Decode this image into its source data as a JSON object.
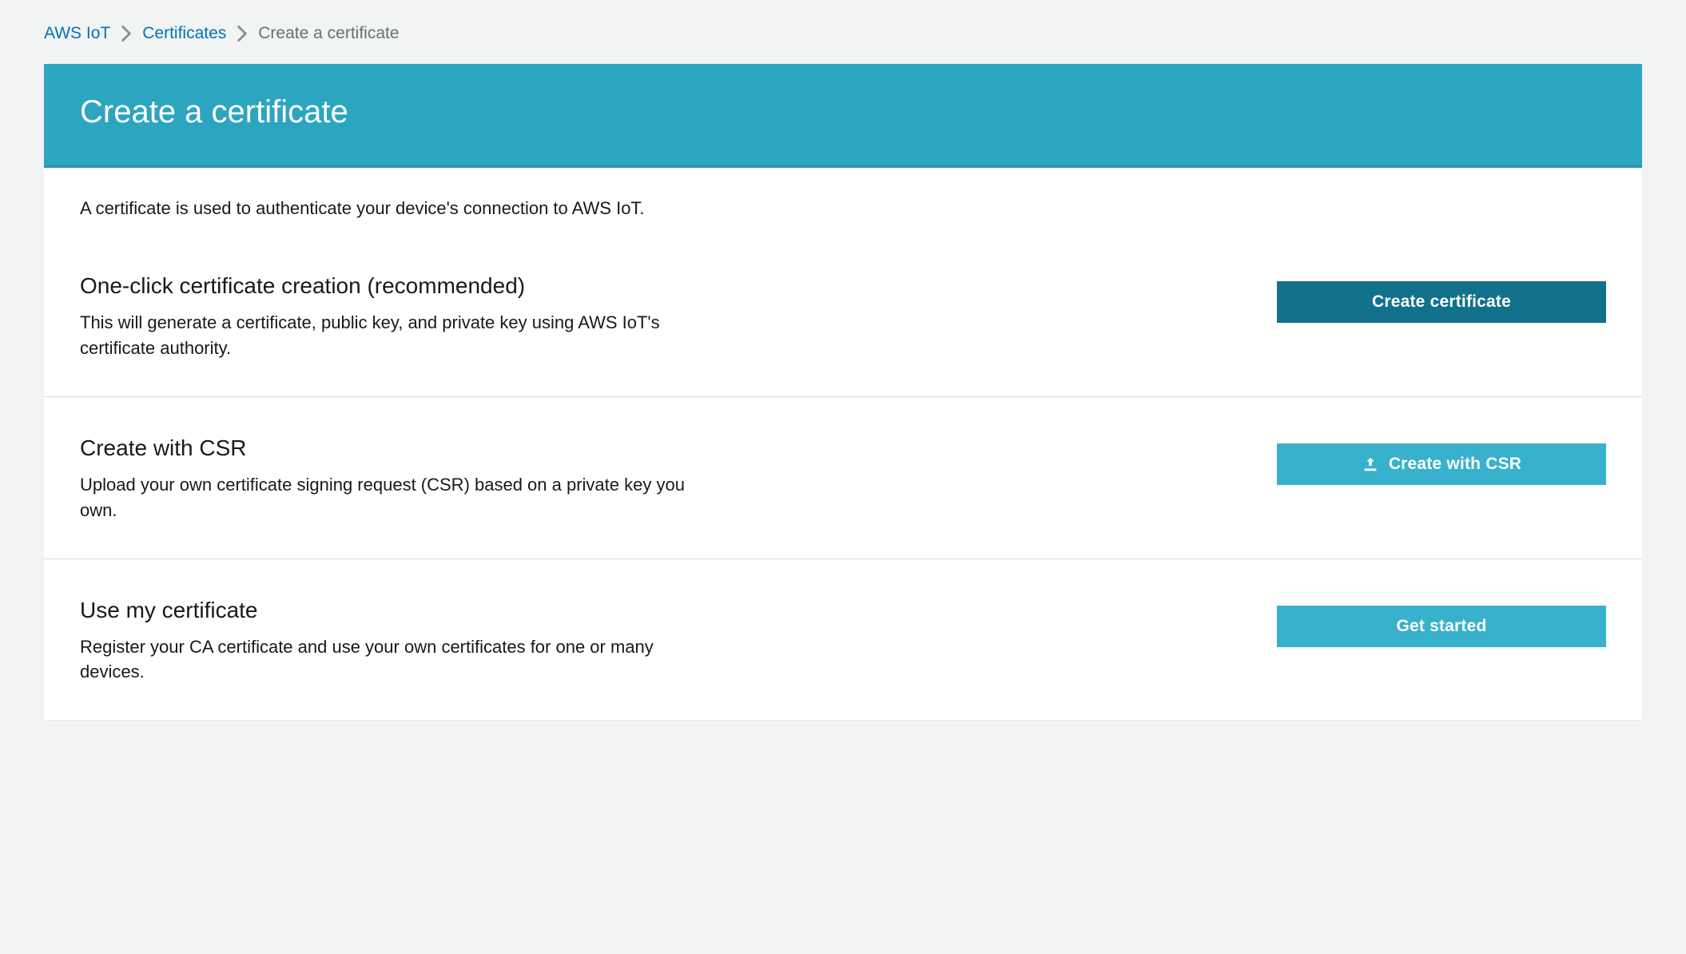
{
  "breadcrumb": {
    "items": [
      {
        "label": "AWS IoT"
      },
      {
        "label": "Certificates"
      }
    ],
    "current": "Create a certificate"
  },
  "header": {
    "title": "Create a certificate"
  },
  "intro": "A certificate is used to authenticate your device's connection to AWS IoT.",
  "options": [
    {
      "title": "One-click certificate creation (recommended)",
      "desc": "This will generate a certificate, public key, and private key using AWS IoT's certificate authority.",
      "button": "Create certificate"
    },
    {
      "title": "Create with CSR",
      "desc": "Upload your own certificate signing request (CSR) based on a private key you own.",
      "button": "Create with CSR"
    },
    {
      "title": "Use my certificate",
      "desc": "Register your CA certificate and use your own certificates for one or many devices.",
      "button": "Get started"
    }
  ]
}
